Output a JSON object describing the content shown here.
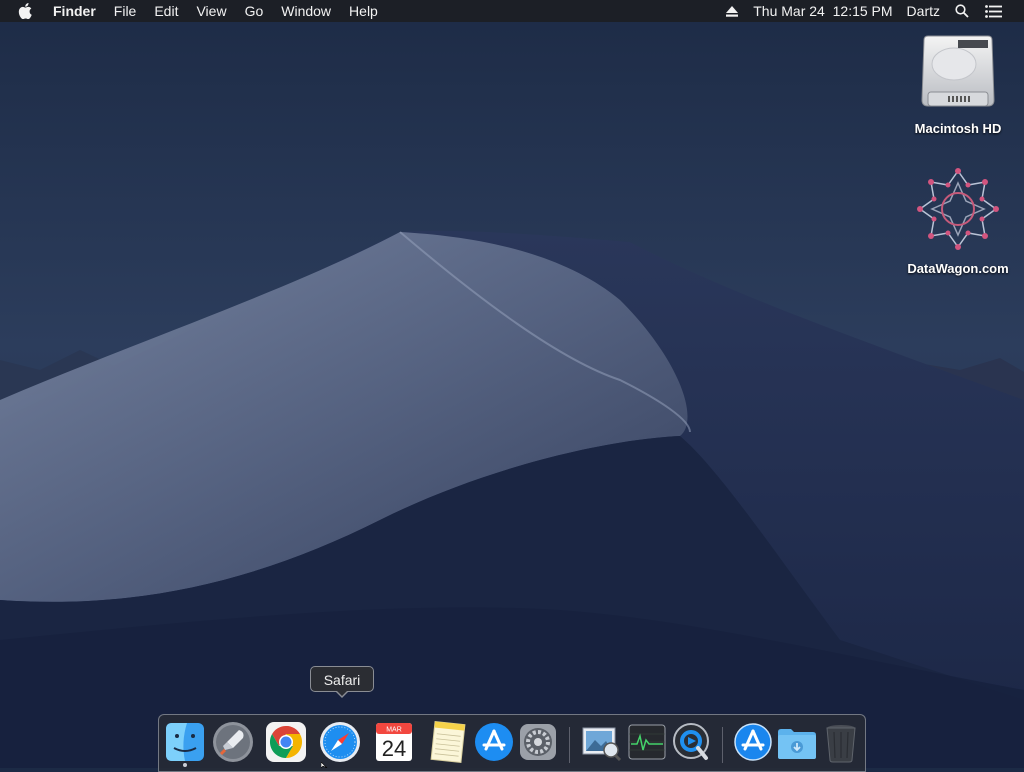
{
  "menubar": {
    "apple_icon": "apple-icon",
    "app_name": "Finder",
    "menus": [
      "File",
      "Edit",
      "View",
      "Go",
      "Window",
      "Help"
    ],
    "status": {
      "eject_icon": "eject-icon",
      "datetime": "Thu Mar 24  12:15 PM",
      "user": "Dartz",
      "search_icon": "spotlight-search-icon",
      "list_icon": "notification-center-icon"
    }
  },
  "desktop": {
    "icons": [
      {
        "label": "Macintosh HD",
        "icon": "hard-drive-icon"
      },
      {
        "label": "DataWagon.com",
        "icon": "datawagon-star-icon"
      }
    ]
  },
  "tooltip": {
    "label": "Safari"
  },
  "dock": {
    "items": [
      {
        "name": "Finder",
        "icon": "finder-icon",
        "running": true
      },
      {
        "name": "Launchpad",
        "icon": "launchpad-icon"
      },
      {
        "name": "Google Chrome",
        "icon": "chrome-icon"
      },
      {
        "name": "Safari",
        "icon": "safari-icon"
      },
      {
        "name": "Calendar",
        "icon": "calendar-icon",
        "month": "MAR",
        "day": "24"
      },
      {
        "name": "Notes",
        "icon": "notes-icon"
      },
      {
        "name": "App Store",
        "icon": "app-store-icon"
      },
      {
        "name": "System Preferences",
        "icon": "system-preferences-icon"
      },
      {
        "name": "Preview",
        "icon": "preview-icon"
      },
      {
        "name": "Activity Monitor",
        "icon": "activity-monitor-icon"
      },
      {
        "name": "QuickTime Player",
        "icon": "quicktime-icon"
      },
      {
        "name": "Applications",
        "icon": "applications-folder-icon"
      },
      {
        "name": "Downloads",
        "icon": "downloads-folder-icon"
      },
      {
        "name": "Trash",
        "icon": "trash-icon"
      }
    ]
  }
}
